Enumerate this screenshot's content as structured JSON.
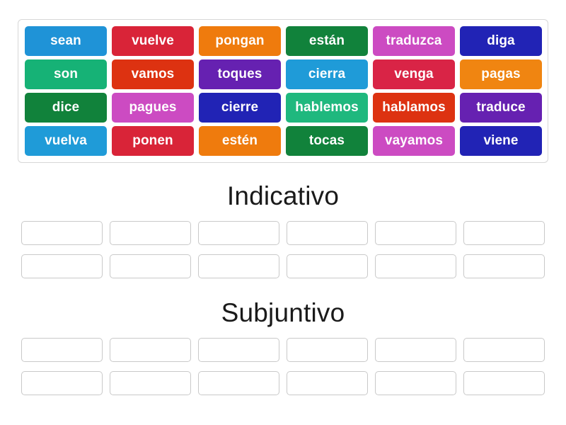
{
  "wordbank": {
    "rows": [
      [
        {
          "label": "sean",
          "color": "#1f93d7"
        },
        {
          "label": "vuelve",
          "color": "#d92438"
        },
        {
          "label": "pongan",
          "color": "#ef7b0d"
        },
        {
          "label": "están",
          "color": "#11823b"
        },
        {
          "label": "traduzca",
          "color": "#cc4bc2"
        },
        {
          "label": "diga",
          "color": "#2123b5"
        }
      ],
      [
        {
          "label": "son",
          "color": "#16b276"
        },
        {
          "label": "vamos",
          "color": "#dd3211"
        },
        {
          "label": "toques",
          "color": "#6621b1"
        },
        {
          "label": "cierra",
          "color": "#1f9bd8"
        },
        {
          "label": "venga",
          "color": "#d92446"
        },
        {
          "label": "pagas",
          "color": "#f08511"
        }
      ],
      [
        {
          "label": "dice",
          "color": "#11823b"
        },
        {
          "label": "pagues",
          "color": "#cc4bc2"
        },
        {
          "label": "cierre",
          "color": "#2123b5"
        },
        {
          "label": "hablemos",
          "color": "#1fb87e"
        },
        {
          "label": "hablamos",
          "color": "#dd3211"
        },
        {
          "label": "traduce",
          "color": "#6621b1"
        }
      ],
      [
        {
          "label": "vuelva",
          "color": "#1f9bd8"
        },
        {
          "label": "ponen",
          "color": "#d92438"
        },
        {
          "label": "estén",
          "color": "#ef7b0d"
        },
        {
          "label": "tocas",
          "color": "#11823b"
        },
        {
          "label": "vayamos",
          "color": "#cc4bc2"
        },
        {
          "label": "viene",
          "color": "#2123b5"
        }
      ]
    ]
  },
  "sections": [
    {
      "title": "Indicativo",
      "slot_rows": [
        [
          "",
          "",
          "",
          "",
          "",
          ""
        ],
        [
          "",
          "",
          "",
          "",
          "",
          ""
        ]
      ]
    },
    {
      "title": "Subjuntivo",
      "slot_rows": [
        [
          "",
          "",
          "",
          "",
          "",
          ""
        ],
        [
          "",
          "",
          "",
          "",
          "",
          ""
        ]
      ]
    }
  ],
  "colors": {
    "page_background": "#ffffff",
    "wordbank_border": "#d7d7d7",
    "dropbox_border": "#c9c9c9",
    "tile_text": "#ffffff",
    "heading_text": "#1a1a1a"
  }
}
